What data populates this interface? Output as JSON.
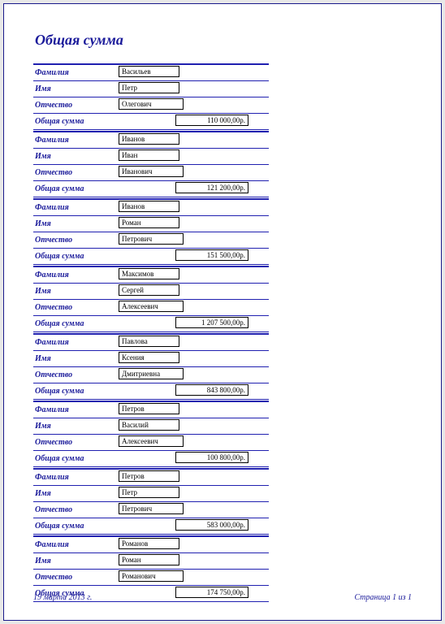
{
  "title": "Общая сумма",
  "labels": {
    "surname": "Фамилия",
    "name": "Имя",
    "patronymic": "Отчество",
    "sum": "Общая сумма"
  },
  "records": [
    {
      "surname": "Васильев",
      "name": "Петр",
      "patronymic": "Олегович",
      "sum": "110 000,00р."
    },
    {
      "surname": "Иванов",
      "name": "Иван",
      "patronymic": "Иванович",
      "sum": "121 200,00р."
    },
    {
      "surname": "Иванов",
      "name": "Роман",
      "patronymic": "Петрович",
      "sum": "151 500,00р."
    },
    {
      "surname": "Максимов",
      "name": "Сергей",
      "patronymic": "Алексеевич",
      "sum": "1 207 500,00р."
    },
    {
      "surname": "Павлова",
      "name": "Ксения",
      "patronymic": "Дмитриевна",
      "sum": "843 800,00р."
    },
    {
      "surname": "Петров",
      "name": "Василий",
      "patronymic": "Алексеевич",
      "sum": "100 800,00р."
    },
    {
      "surname": "Петров",
      "name": "Петр",
      "patronymic": "Петрович",
      "sum": "583 000,00р."
    },
    {
      "surname": "Романов",
      "name": "Роман",
      "patronymic": "Романович",
      "sum": "174 750,00р."
    }
  ],
  "footer": {
    "date": "19 марта 2013 г.",
    "page": "Страница 1 из 1"
  }
}
